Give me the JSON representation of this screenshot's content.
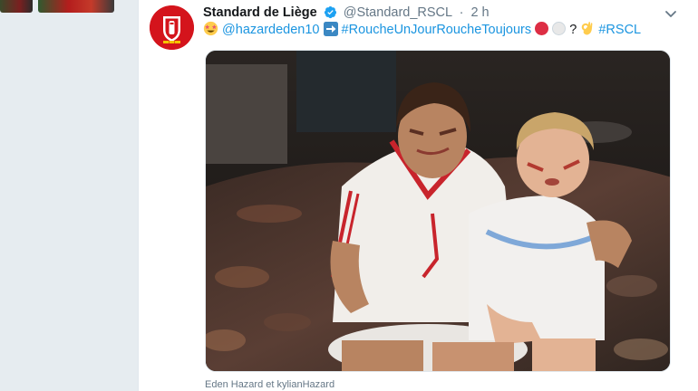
{
  "tweet": {
    "author_name": "Standard de Liège",
    "handle": "@Standard_RSCL",
    "separator": "·",
    "time": "2 h",
    "mention": "@hazardeden10",
    "hashtag_main": "#RoucheUnJourRoucheToujours",
    "question": "?",
    "hashtag_club": "#RSCL"
  },
  "icons": {
    "verified": "verified-badge-icon",
    "caret": "chevron-down-icon",
    "star_eyes": "star-struck-emoji-icon",
    "arrow": "right-arrow-emoji-icon",
    "red_circle": "red-circle-emoji-icon",
    "white_circle": "white-circle-emoji-icon",
    "ok_hand": "ok-hand-emoji-icon"
  },
  "media": {
    "caption": "Eden Hazard et kylianHazard"
  },
  "colors": {
    "accent": "#1b95e0",
    "club_red": "#d4141c",
    "text": "#14171a",
    "muted": "#657786"
  }
}
